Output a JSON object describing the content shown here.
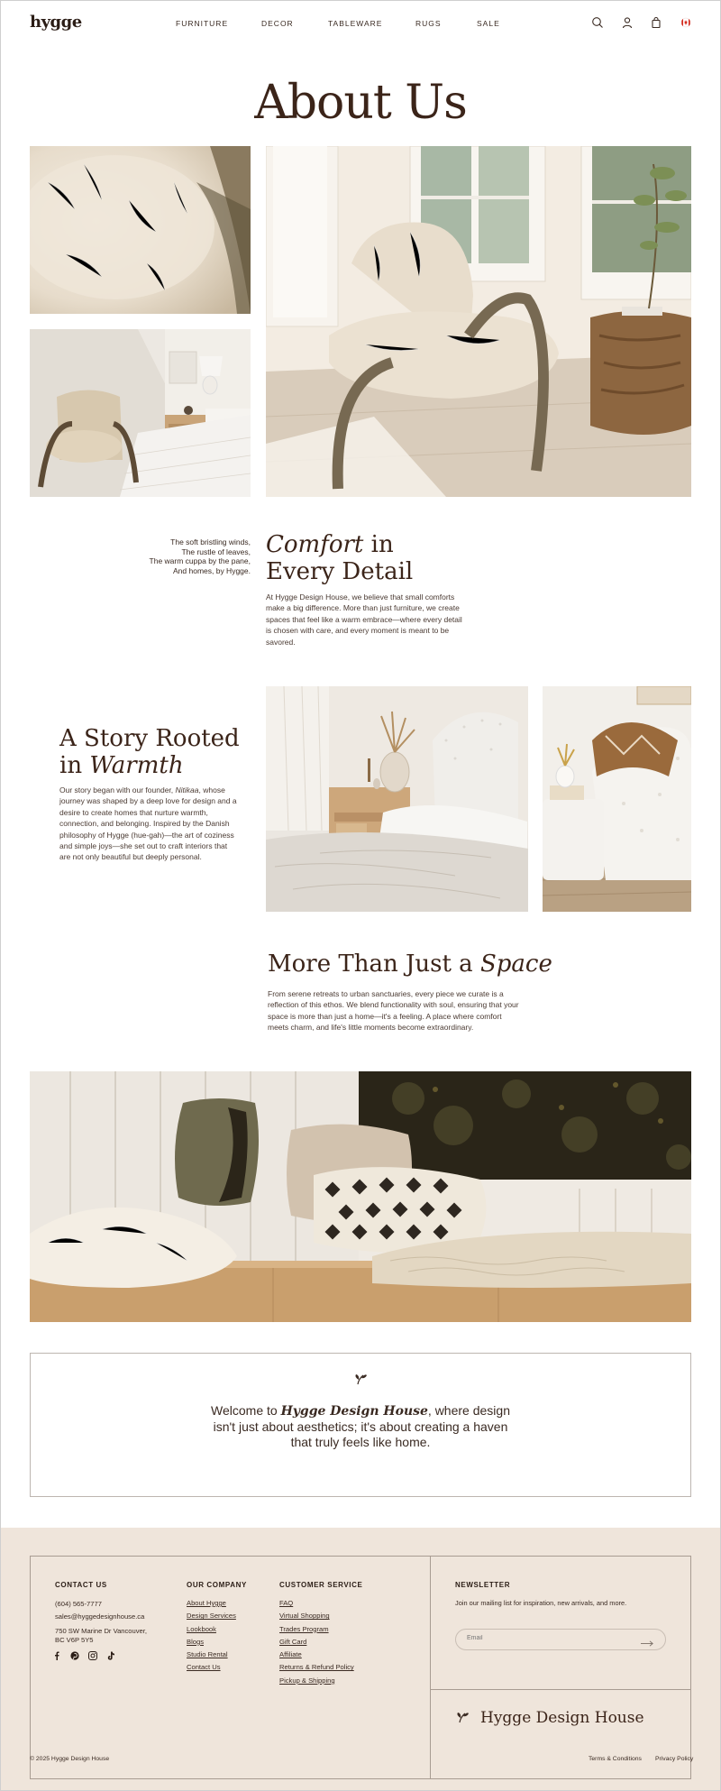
{
  "header": {
    "logo": "hygge",
    "nav": [
      "FURNITURE",
      "DECOR",
      "TABLEWARE",
      "RUGS",
      "SALE"
    ],
    "icons": [
      "search-icon",
      "account-icon",
      "bag-icon",
      "canada-flag-icon"
    ]
  },
  "hero": {
    "title": "About Us"
  },
  "comfort": {
    "poem": [
      "The soft bristling winds,",
      "The rustle of leaves,",
      "The warm cuppa by the pane,",
      "And homes, by Hygge."
    ],
    "heading_italic": "Comfort",
    "heading_rest": " in",
    "heading_line2": "Every Detail",
    "body": "At Hygge Design House, we believe that small comforts make a big difference. More than just furniture, we create spaces that feel like a warm embrace—where every detail is chosen with care, and every moment is meant to be savored."
  },
  "story": {
    "heading_line1": "A Story Rooted",
    "heading_line2_prefix": "in ",
    "heading_line2_italic": "Warmth",
    "body_pre": "Our story began with our founder, ",
    "founder": "Nitikaa",
    "body_post": ", whose journey was shaped by a deep love for design and a desire to create homes that nurture warmth, connection, and belonging. Inspired by the Danish philosophy of Hygge (hue-gah)—the art of coziness and simple joys—she set out to craft interiors that are not only beautiful but deeply personal."
  },
  "space": {
    "heading_prefix": "More Than Just a ",
    "heading_italic": "Space",
    "body": "From serene retreats to urban sanctuaries, every piece we curate is a reflection of this ethos. We blend functionality with soul, ensuring that your space is more than just a home—it's a feeling. A place where comfort meets charm, and life's little moments become extraordinary."
  },
  "welcome": {
    "prefix": "Welcome to ",
    "brand_italic": "Hygge Design House",
    "suffix": ", where design isn't just about aesthetics; it's about creating a haven that truly feels like home."
  },
  "footer": {
    "contact": {
      "heading": "CONTACT US",
      "phone": "(604) 565-7777",
      "email": "sales@hyggedesignhouse.ca",
      "address_line1": "750 SW Marine Dr Vancouver,",
      "address_line2": "BC V6P 5Y5",
      "social": [
        "facebook-icon",
        "pinterest-icon",
        "instagram-icon",
        "tiktok-icon"
      ]
    },
    "company": {
      "heading": "OUR COMPANY",
      "links": [
        "About Hygge",
        "Design Services",
        "Lookbook",
        "Blogs",
        "Studio Rental",
        "Contact Us"
      ]
    },
    "service": {
      "heading": "CUSTOMER SERVICE",
      "links": [
        "FAQ",
        "Virtual Shopping",
        "Trades Program",
        "Gift Card",
        "Affiliate",
        "Returns & Refund Policy",
        "Pickup & Shipping"
      ]
    },
    "newsletter": {
      "heading": "NEWSLETTER",
      "text": "Join our mailing list for inspiration, new arrivals, and more.",
      "placeholder": "Email"
    },
    "brand": "Hygge Design House",
    "copyright": "© 2025 Hygge Design House",
    "legal": [
      "Terms & Conditions",
      "Privacy Policy"
    ]
  },
  "colors": {
    "heading": "#3b2419",
    "footer_bg": "#efe5db",
    "flag_red": "#d52b1e"
  }
}
